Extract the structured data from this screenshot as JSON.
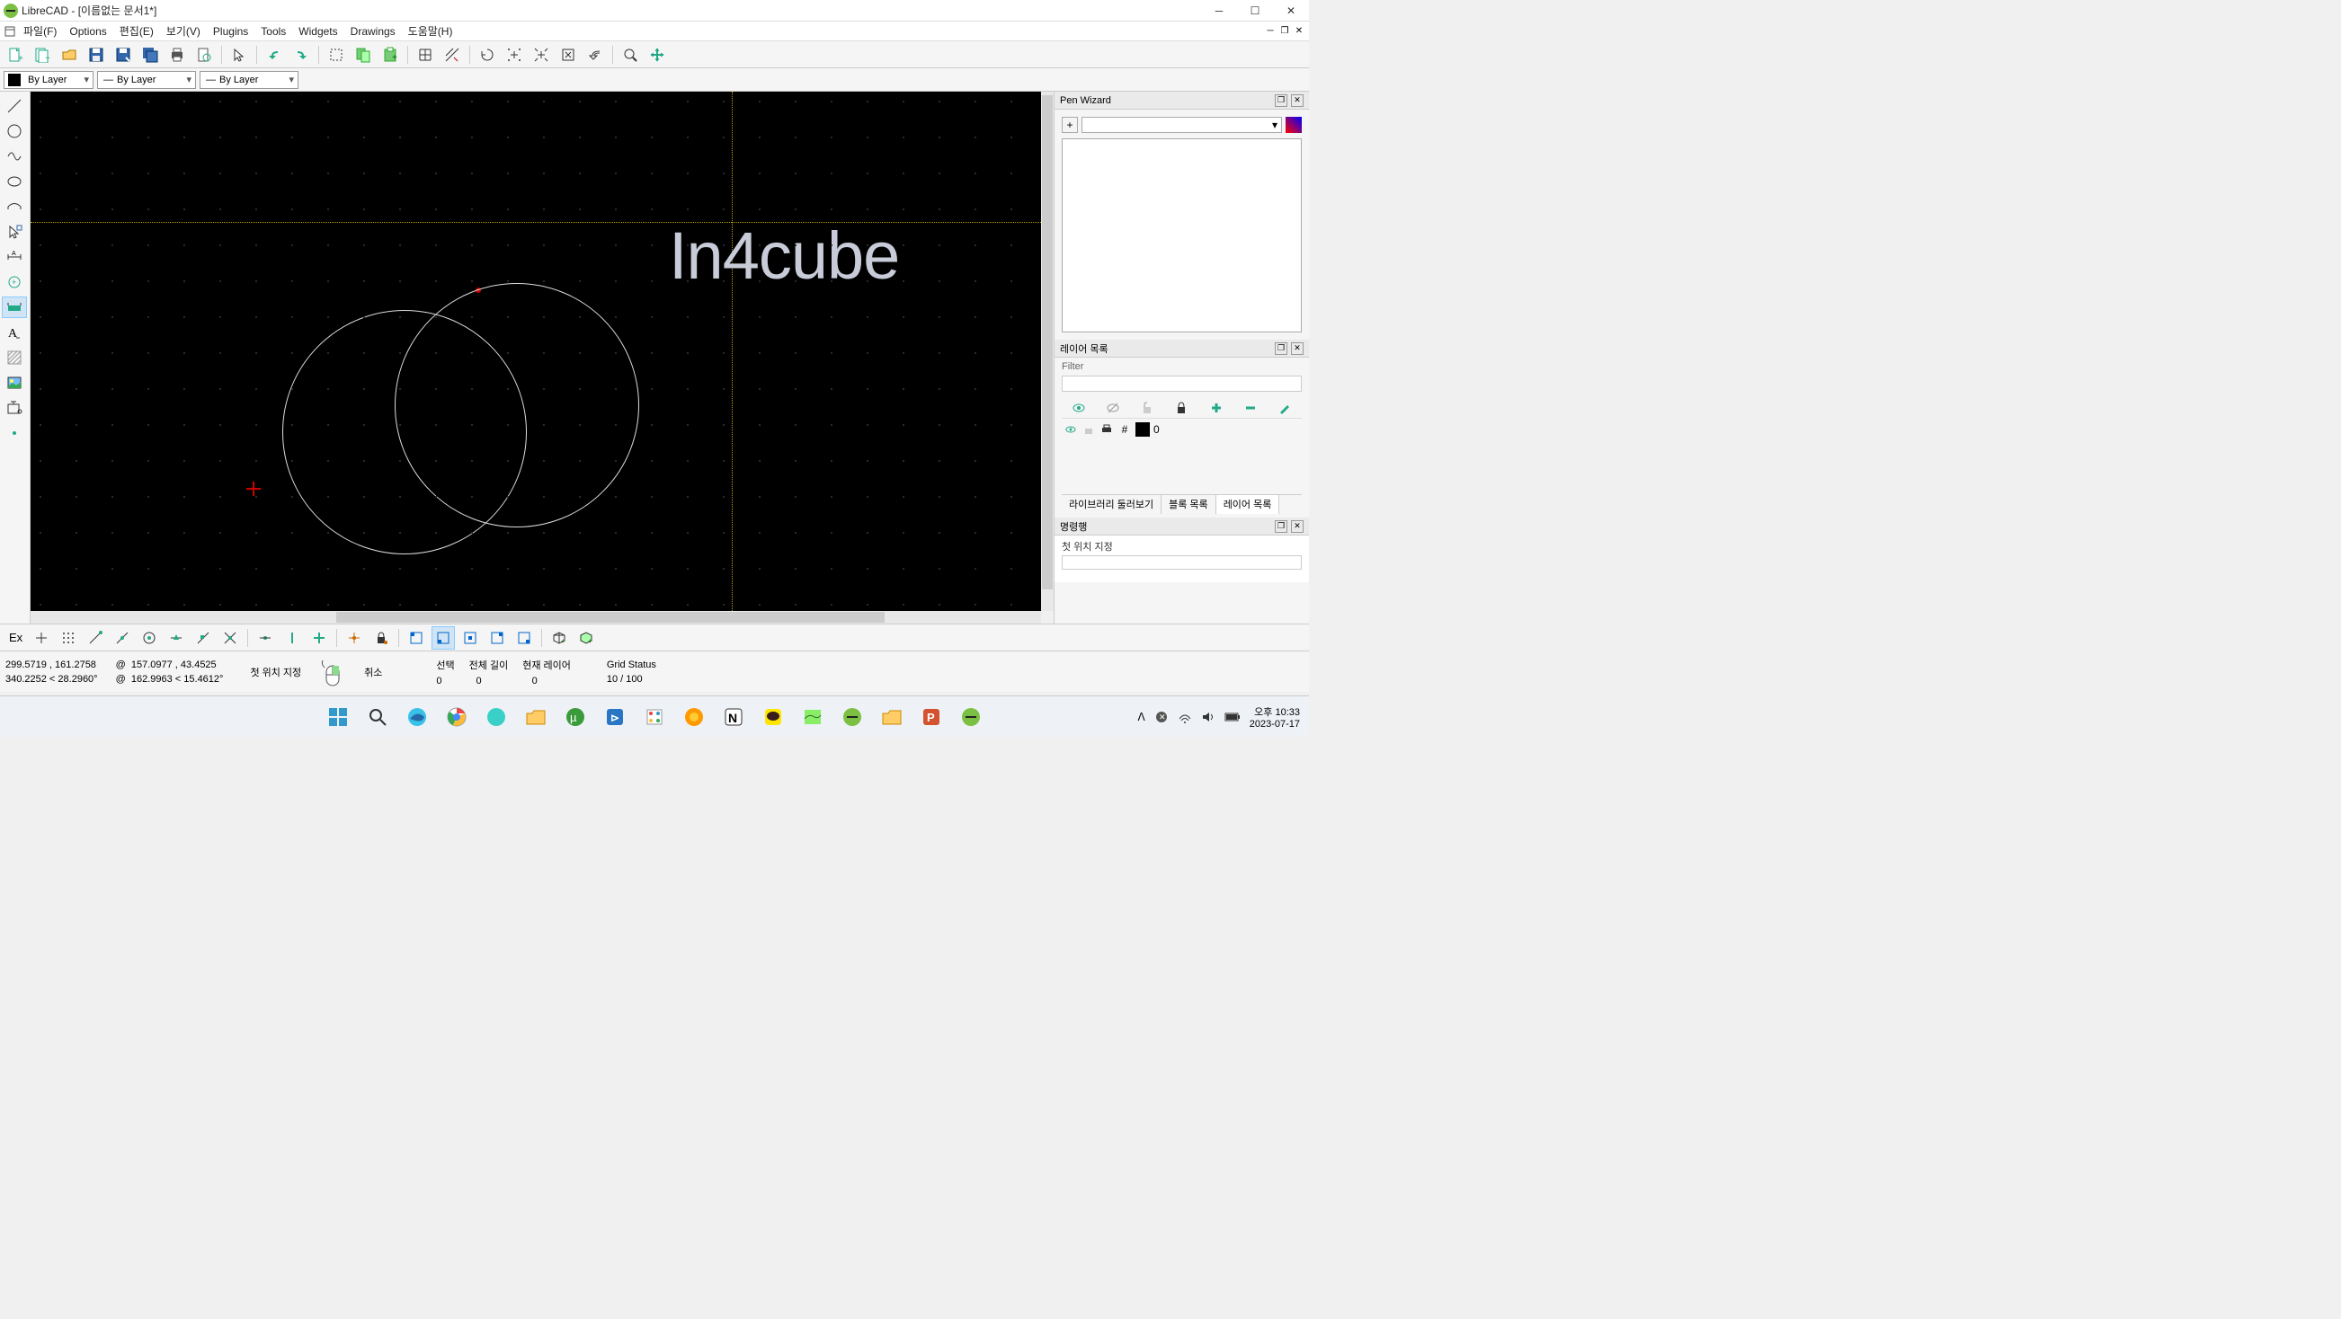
{
  "titlebar": {
    "app_name": "LibreCAD",
    "doc_title": "[이름없는 문서1*]"
  },
  "menubar": {
    "items": [
      "파일(F)",
      "Options",
      "편집(E)",
      "보기(V)",
      "Plugins",
      "Tools",
      "Widgets",
      "Drawings",
      "도움말(H)"
    ]
  },
  "pen": {
    "color_label": "By Layer",
    "width_label": "By Layer",
    "type_label": "By Layer"
  },
  "watermark": "In4cube",
  "panels": {
    "pen_wizard": {
      "title": "Pen Wizard"
    },
    "layers": {
      "title": "레이어 목록",
      "filter_label": "Filter",
      "layer0": "0",
      "tabs": [
        "라이브러리 둘러보기",
        "블록 목록",
        "레이어 목록"
      ]
    },
    "command": {
      "title": "명령행",
      "prompt": "첫 위치 지정"
    }
  },
  "snapbar": {
    "ex": "Ex"
  },
  "status": {
    "abs": "299.5719 , 161.2758",
    "polar_abs": "340.2252 < 28.2960°",
    "rel": "157.0977 , 43.4525",
    "polar_rel": "162.9963 < 15.4612°",
    "prompt": "첫 위치 지정",
    "cancel": "취소",
    "sel_label": "선택",
    "sel_val": "0",
    "len_label": "전체 길이",
    "len_val": "0",
    "layer_label": "현재 레이어",
    "layer_val": "0",
    "grid_label": "Grid Status",
    "grid_val": "10 / 100"
  },
  "taskbar": {
    "time": "오후 10:33",
    "date": "2023-07-17"
  }
}
